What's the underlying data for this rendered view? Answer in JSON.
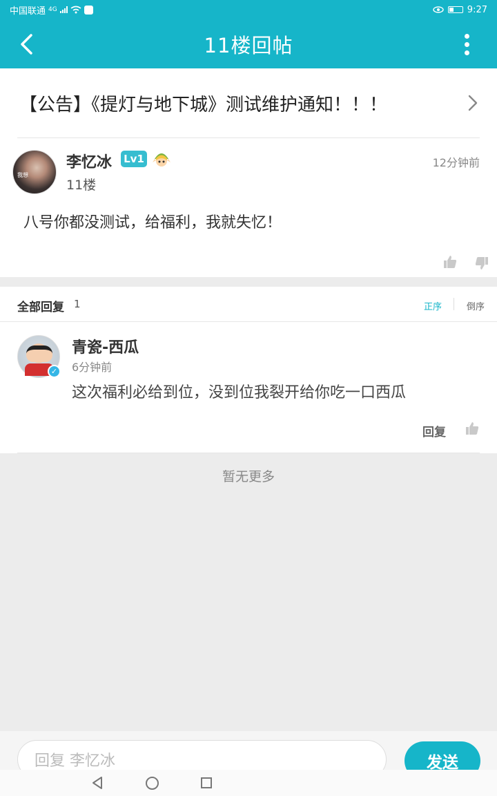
{
  "status_bar": {
    "carrier": "中国联通",
    "network": "4G",
    "time": "9:27"
  },
  "header": {
    "title": "11楼回帖"
  },
  "notice": {
    "text": "【公告】《提灯与地下城》测试维护通知！！！"
  },
  "post": {
    "author": "李忆冰",
    "level": "Lv1",
    "avatar_caption": "我想",
    "floor": "11楼",
    "time": "12分钟前",
    "content": "八号你都没测试，给福利，我就失忆！"
  },
  "replies_header": {
    "title": "全部回复",
    "count": "1",
    "sort_asc": "正序",
    "sort_desc": "倒序"
  },
  "replies": [
    {
      "author": "青瓷-西瓜",
      "time": "6分钟前",
      "content": "这次福利必给到位，没到位我裂开给你吃一口西瓜",
      "reply_label": "回复"
    }
  ],
  "no_more": "暂无更多",
  "composer": {
    "placeholder": "回复 李忆冰",
    "send_label": "发送"
  },
  "colors": {
    "accent": "#16b5c9",
    "background": "#ececec"
  }
}
